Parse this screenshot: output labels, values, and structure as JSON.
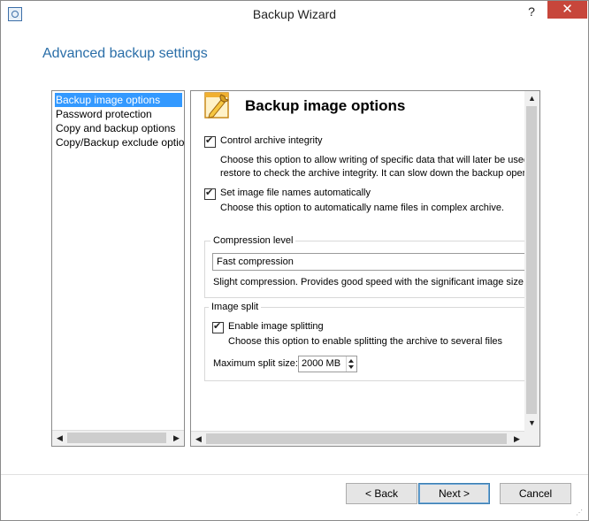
{
  "window": {
    "title": "Backup Wizard",
    "help_label": "?",
    "close_label": "✕"
  },
  "heading": "Advanced backup settings",
  "left_nav": {
    "items": [
      {
        "label": "Backup image options",
        "selected": true
      },
      {
        "label": "Password protection",
        "selected": false
      },
      {
        "label": "Copy and backup options",
        "selected": false
      },
      {
        "label": "Copy/Backup exclude options",
        "selected": false
      }
    ]
  },
  "page": {
    "title": "Backup image options",
    "icon": "wrench-pencil-settings-icon",
    "control_integrity": {
      "label": "Control archive integrity",
      "checked": true,
      "desc_line1": "Choose this option to allow writing of specific data that will later be used d",
      "desc_line2": "restore to check the archive integrity. It can slow down the backup opera"
    },
    "auto_names": {
      "label": "Set image file names automatically",
      "checked": true,
      "desc": "Choose this option to automatically name files in complex archive."
    },
    "compression": {
      "group_label": "Compression level",
      "selected": "Fast compression",
      "desc": "Slight compression. Provides good speed with the significant image size."
    },
    "image_split": {
      "group_label": "Image split",
      "enable_label": "Enable image splitting",
      "checked": true,
      "desc": "Choose this option to enable splitting the archive to several files",
      "max_size_label": "Maximum split size:",
      "max_size_value": "2000 MB"
    }
  },
  "buttons": {
    "back": "< Back",
    "next": "Next >",
    "cancel": "Cancel"
  },
  "colors": {
    "heading": "#2a6ea8",
    "selection": "#3399ff",
    "close": "#c7463b"
  }
}
